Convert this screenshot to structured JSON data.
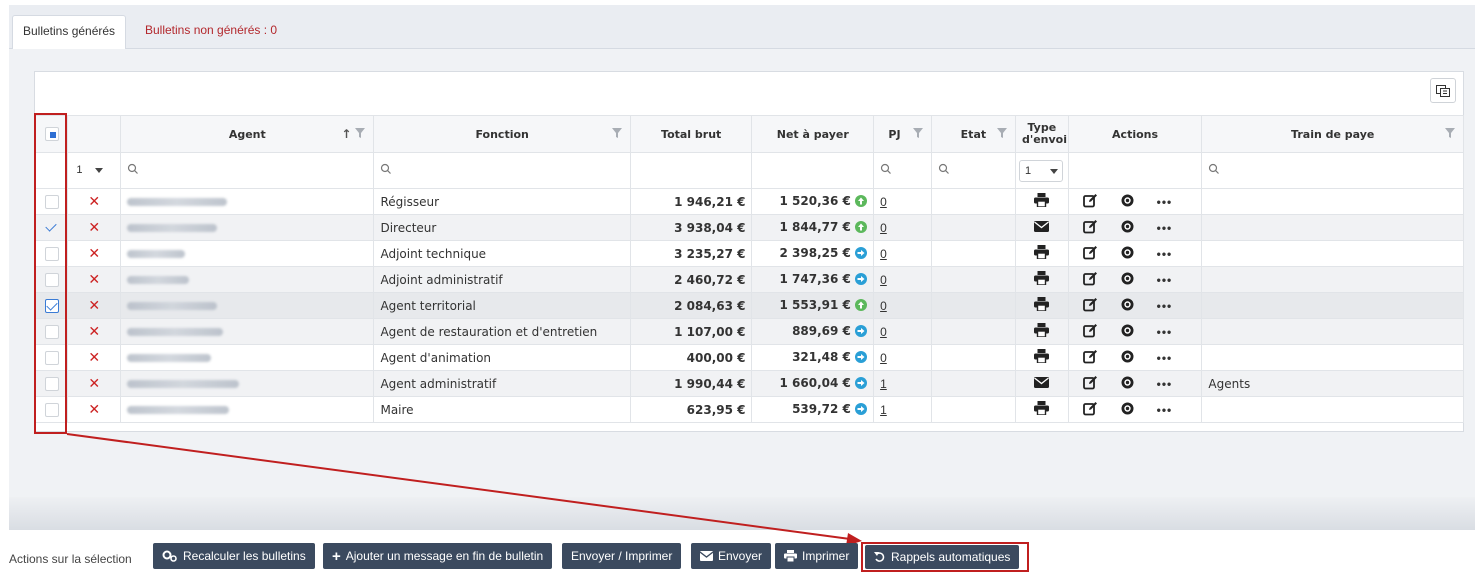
{
  "tabs": [
    {
      "label": "Bulletins générés",
      "active": true
    },
    {
      "label": "Bulletins non générés : 0",
      "active": false
    }
  ],
  "columns": {
    "agent": "Agent",
    "fonction": "Fonction",
    "total_brut": "Total brut",
    "net_a_payer": "Net à payer",
    "pj": "PJ",
    "etat": "Etat",
    "type_envoi": "Type d'envoi",
    "actions": "Actions",
    "train_de_paye": "Train de paye"
  },
  "filters": {
    "status_select": "1",
    "type_envoi_select": "1"
  },
  "rows": [
    {
      "fonction": "Régisseur",
      "total_brut": "1 946,21 €",
      "net": "1 520,36 €",
      "net_icon": "up-arrow-icon",
      "pj": "0",
      "type_icon": "print-icon",
      "train": "",
      "checked": false
    },
    {
      "fonction": "Directeur",
      "total_brut": "3 938,04 €",
      "net": "1 844,77 €",
      "net_icon": "up-arrow-icon",
      "pj": "0",
      "type_icon": "envelope-icon",
      "train": "",
      "checked": true
    },
    {
      "fonction": "Adjoint technique",
      "total_brut": "3 235,27 €",
      "net": "2 398,25 €",
      "net_icon": "right-arrow-icon",
      "pj": "0",
      "type_icon": "print-icon",
      "train": "",
      "checked": false
    },
    {
      "fonction": "Adjoint administratif",
      "total_brut": "2 460,72 €",
      "net": "1 747,36 €",
      "net_icon": "right-arrow-icon",
      "pj": "0",
      "type_icon": "print-icon",
      "train": "",
      "checked": false
    },
    {
      "fonction": "Agent territorial",
      "total_brut": "2 084,63 €",
      "net": "1 553,91 €",
      "net_icon": "up-arrow-icon",
      "pj": "0",
      "type_icon": "print-icon",
      "train": "",
      "checked": true
    },
    {
      "fonction": "Agent de restauration et d'entretien",
      "total_brut": "1 107,00 €",
      "net": "889,69 €",
      "net_icon": "right-arrow-icon",
      "pj": "0",
      "type_icon": "print-icon",
      "train": "",
      "checked": false
    },
    {
      "fonction": "Agent d'animation",
      "total_brut": "400,00 €",
      "net": "321,48 €",
      "net_icon": "right-arrow-icon",
      "pj": "0",
      "type_icon": "print-icon",
      "train": "",
      "checked": false
    },
    {
      "fonction": "Agent administratif",
      "total_brut": "1 990,44 €",
      "net": "1 660,04 €",
      "net_icon": "right-arrow-icon",
      "pj": "1",
      "type_icon": "envelope-icon",
      "train": "Agents",
      "checked": false
    },
    {
      "fonction": "Maire",
      "total_brut": "623,95 €",
      "net": "539,72 €",
      "net_icon": "right-arrow-icon",
      "pj": "1",
      "type_icon": "print-icon",
      "train": "",
      "checked": false
    }
  ],
  "action_bar": {
    "label": "Actions sur la sélection",
    "buttons": [
      {
        "label": "Recalculer les bulletins",
        "icon": "cogs-icon"
      },
      {
        "label": "Ajouter un message en fin de bulletin",
        "icon": "plus-icon"
      },
      {
        "label": "Envoyer / Imprimer",
        "icon": ""
      },
      {
        "label": "Envoyer",
        "icon": "envelope-icon"
      },
      {
        "label": "Imprimer",
        "icon": "print-icon"
      },
      {
        "label": "Rappels automatiques",
        "icon": "undo-icon"
      }
    ]
  },
  "colors": {
    "accent_dark": "#3b4a5f",
    "highlight_red": "#c01f1f",
    "link_red": "#b3272c"
  }
}
